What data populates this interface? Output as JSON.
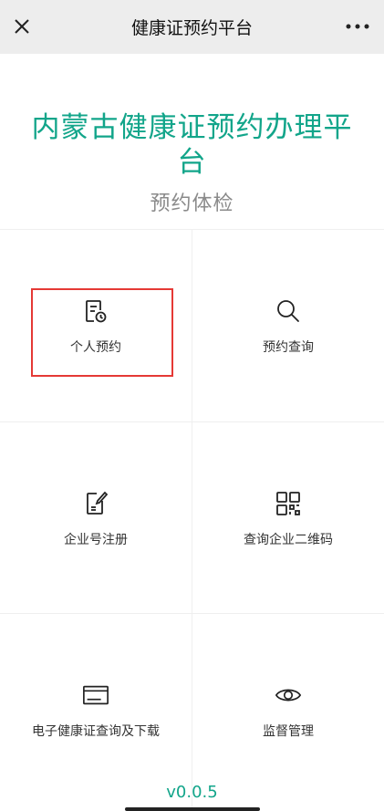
{
  "nav": {
    "title": "健康证预约平台",
    "close_icon": "close-icon",
    "more_icon": "more-icon"
  },
  "hero": {
    "title": "内蒙古健康证预约办理平台",
    "subtitle": "预约体检"
  },
  "menu": [
    {
      "label": "个人预约",
      "icon": "appointment-clock-icon"
    },
    {
      "label": "预约查询",
      "icon": "search-icon"
    },
    {
      "label": "企业号注册",
      "icon": "register-edit-icon"
    },
    {
      "label": "查询企业二维码",
      "icon": "qr-code-icon"
    },
    {
      "label": "电子健康证查询及下载",
      "icon": "card-icon"
    },
    {
      "label": "监督管理",
      "icon": "eye-icon"
    }
  ],
  "version": "v0.0.5",
  "colors": {
    "accent": "#12a58a",
    "highlight": "#e53935",
    "nav_bg": "#ededed"
  }
}
